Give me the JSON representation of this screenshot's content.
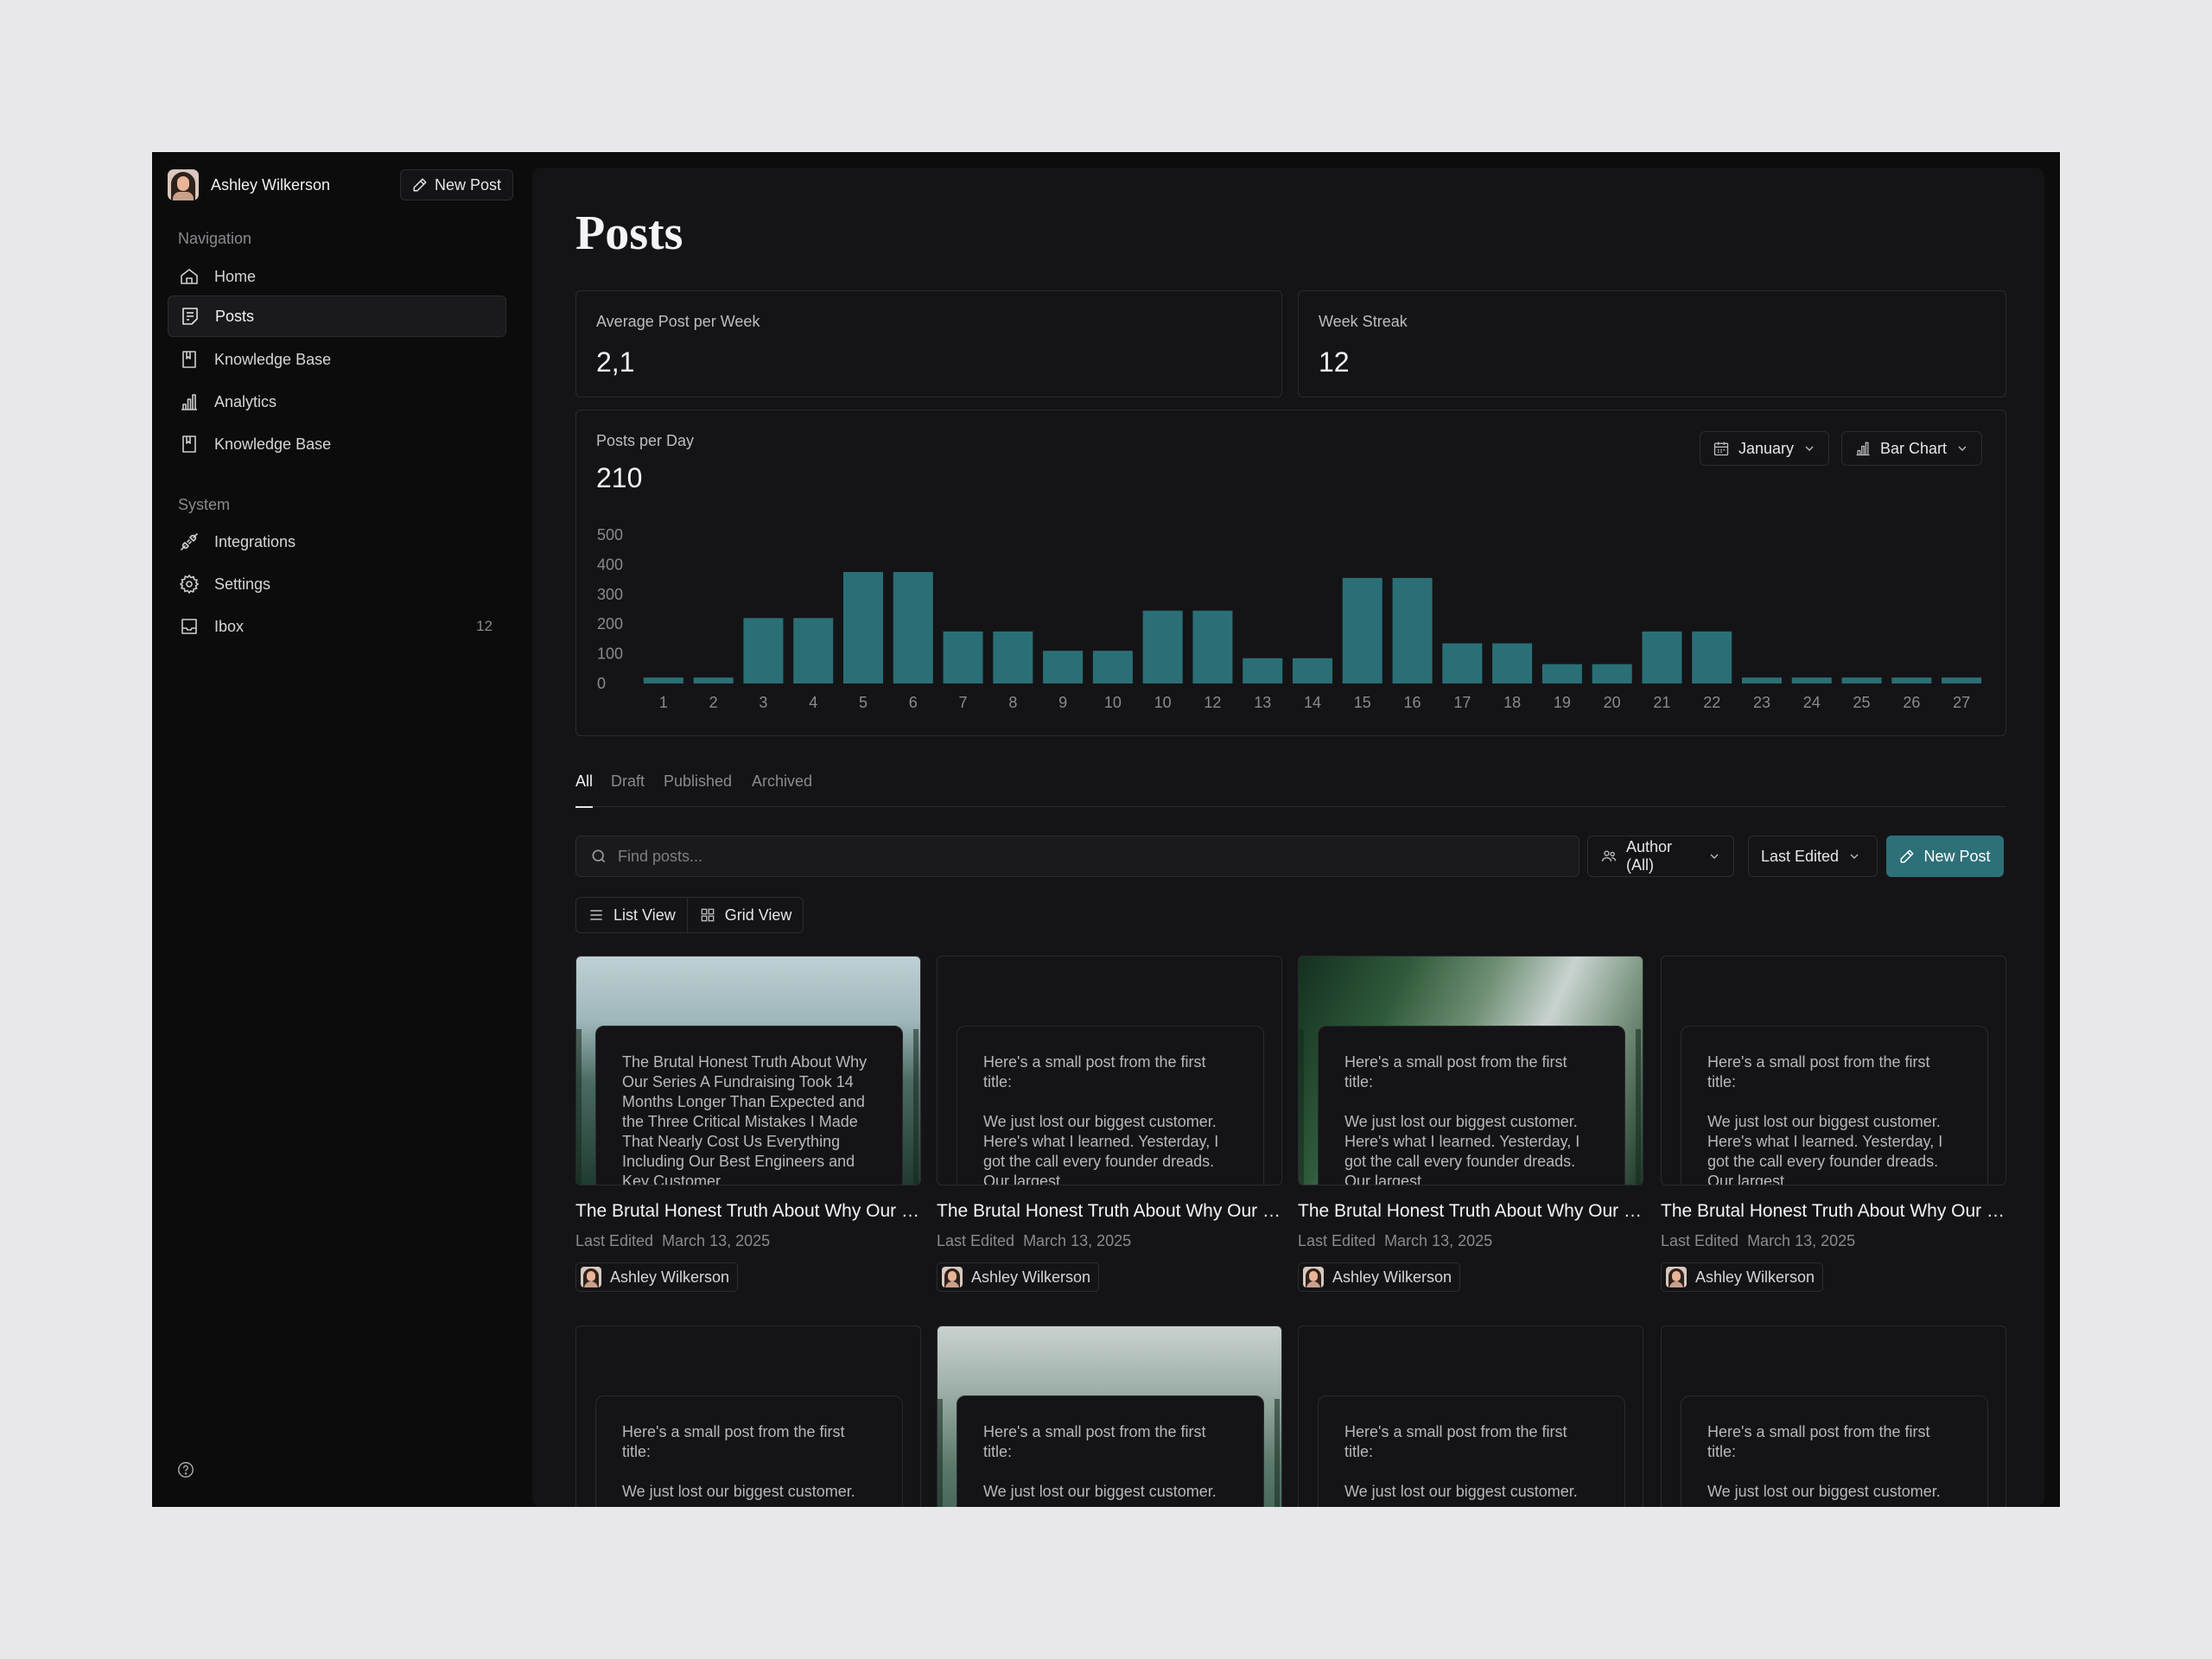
{
  "user": {
    "name": "Ashley Wilkerson"
  },
  "sidebar": {
    "new_post_label": "New Post",
    "nav_heading": "Navigation",
    "nav_items": [
      {
        "label": "Home",
        "icon": "home-icon"
      },
      {
        "label": "Posts",
        "icon": "posts-icon",
        "active": true
      },
      {
        "label": "Knowledge Base",
        "icon": "book-icon"
      },
      {
        "label": "Analytics",
        "icon": "analytics-icon"
      },
      {
        "label": "Knowledge Base",
        "icon": "book-icon"
      }
    ],
    "system_heading": "System",
    "system_items": [
      {
        "label": "Integrations",
        "icon": "plug-icon"
      },
      {
        "label": "Settings",
        "icon": "gear-icon"
      },
      {
        "label": "Ibox",
        "icon": "inbox-icon",
        "badge": "12"
      }
    ],
    "help_icon": "help-icon"
  },
  "main": {
    "title": "Posts",
    "stats": [
      {
        "label": "Average Post per Week",
        "value": "2,1"
      },
      {
        "label": "Week Streak",
        "value": "12"
      }
    ],
    "chart_card": {
      "label": "Posts per Day",
      "value": "210",
      "month_dropdown": "January",
      "type_dropdown": "Bar Chart"
    },
    "tabs": [
      "All",
      "Draft",
      "Published",
      "Archived"
    ],
    "search_placeholder": "Find posts...",
    "author_filter": "Author (All)",
    "sort_filter": "Last Edited",
    "new_post_label": "New Post",
    "views": [
      "List View",
      "Grid View"
    ],
    "posts": [
      {
        "excerpt_p1": "The Brutal Honest Truth About Why Our Series A Fundraising Took 14 Months Longer Than Expected and the Three Critical Mistakes I Made That Nearly Cost Us Everything Including Our Best Engineers and Key Customer",
        "excerpt_p2": "",
        "title": "The Brutal Honest Truth About Why Our Series A Fundraising",
        "edited_label": "Last Edited",
        "edited_date": "March 13, 2025",
        "author": "Ashley Wilkerson"
      },
      {
        "excerpt_p1": "Here's a small post from the first title:",
        "excerpt_p2": "We just lost our biggest customer. Here's what I learned. Yesterday, I got the call every founder dreads. Our largest",
        "title": "The Brutal Honest Truth About Why Our Series A Fundraising",
        "edited_label": "Last Edited",
        "edited_date": "March 13, 2025",
        "author": "Ashley Wilkerson"
      },
      {
        "excerpt_p1": "Here's a small post from the first title:",
        "excerpt_p2": "We just lost our biggest customer. Here's what I learned. Yesterday, I got the call every founder dreads. Our largest",
        "title": "The Brutal Honest Truth About Why Our Series A Fundraising",
        "edited_label": "Last Edited",
        "edited_date": "March 13, 2025",
        "author": "Ashley Wilkerson"
      },
      {
        "excerpt_p1": "Here's a small post from the first title:",
        "excerpt_p2": "We just lost our biggest customer. Here's what I learned. Yesterday, I got the call every founder dreads. Our largest",
        "title": "The Brutal Honest Truth About Why Our Series A Fundraising",
        "edited_label": "Last Edited",
        "edited_date": "March 13, 2025",
        "author": "Ashley Wilkerson"
      },
      {
        "excerpt_p1": "Here's a small post from the first title:",
        "excerpt_p2": "We just lost our biggest customer."
      },
      {
        "excerpt_p1": "Here's a small post from the first title:",
        "excerpt_p2": "We just lost our biggest customer."
      },
      {
        "excerpt_p1": "Here's a small post from the first title:",
        "excerpt_p2": "We just lost our biggest customer."
      },
      {
        "excerpt_p1": "Here's a small post from the first title:",
        "excerpt_p2": "We just lost our biggest customer."
      }
    ]
  },
  "colors": {
    "accent": "#2c7078",
    "bar": "#2b6f76",
    "background": "#141416",
    "sidebar": "#0c0c0d"
  },
  "chart_data": {
    "type": "bar",
    "title": "Posts per Day",
    "categories": [
      "1",
      "2",
      "3",
      "4",
      "5",
      "6",
      "7",
      "8",
      "9",
      "10",
      "10",
      "12",
      "13",
      "14",
      "15",
      "16",
      "17",
      "18",
      "19",
      "20",
      "21",
      "22",
      "23",
      "24",
      "25",
      "26",
      "27"
    ],
    "values": [
      20,
      20,
      220,
      220,
      375,
      375,
      175,
      175,
      110,
      110,
      245,
      245,
      85,
      85,
      355,
      355,
      135,
      135,
      65,
      65,
      175,
      175,
      20,
      20,
      20,
      20,
      20
    ],
    "yticks": [
      500,
      400,
      300,
      200,
      100,
      0
    ],
    "ylim": [
      0,
      500
    ],
    "grid": false,
    "legend": "none"
  }
}
